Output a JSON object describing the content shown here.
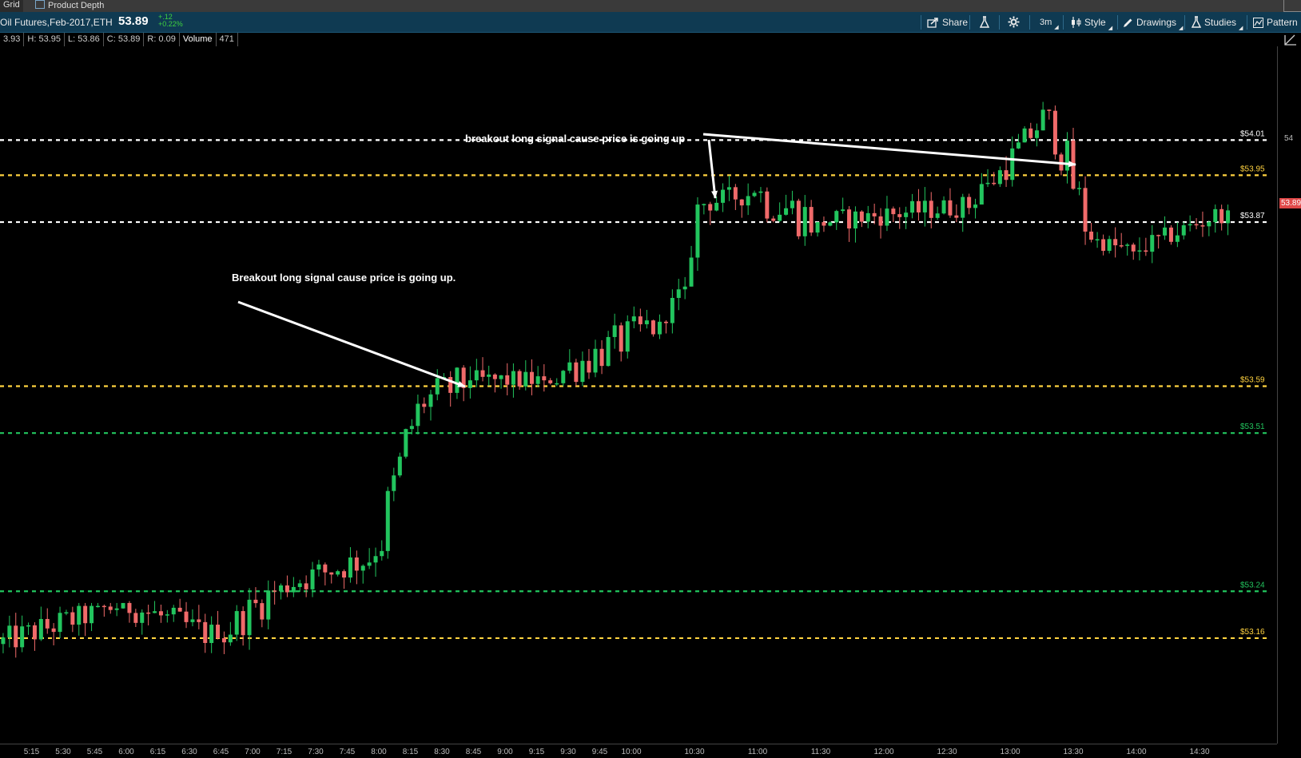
{
  "tabs": [
    {
      "label": "Grid"
    },
    {
      "label": "Product Depth"
    }
  ],
  "toolbar": {
    "symbol": "Oil Futures,Feb-2017,ETH",
    "last_price": "53.89",
    "change_abs": "+.12",
    "change_pct": "+0.22%",
    "share_label": "Share",
    "timeframe_label": "3m",
    "style_label": "Style",
    "drawings_label": "Drawings",
    "studies_label": "Studies",
    "patterns_label": "Pattern"
  },
  "infobar": {
    "open": "3.93",
    "high": "H: 53.95",
    "low": "L: 53.86",
    "close": "C: 53.89",
    "range": "R: 0.09",
    "volume_label": "Volume",
    "volume_value": "471"
  },
  "colors": {
    "up": "#22c55e",
    "down": "#f06a6a",
    "white_line": "#ffffff",
    "yellow_line": "#ffd23f",
    "green_line": "#22c55e",
    "toolbar": "#0f3a52"
  },
  "chart_data": {
    "type": "candlestick",
    "title": "",
    "xlabel": "",
    "ylabel": "",
    "ylim": [
      52.98,
      54.17
    ],
    "x_ticks": [
      "5:15",
      "5:30",
      "5:45",
      "6:00",
      "6:15",
      "6:30",
      "6:45",
      "7:00",
      "7:15",
      "7:30",
      "7:45",
      "8:00",
      "8:15",
      "8:30",
      "8:45",
      "9:00",
      "9:15",
      "9:30",
      "9:45",
      "10:00",
      "10:30",
      "11:00",
      "11:30",
      "12:00",
      "12:30",
      "13:00",
      "13:30",
      "14:00",
      "14:30"
    ],
    "y_ticks": [
      {
        "value": 54,
        "label": "54"
      }
    ],
    "last_price_badge": "53.89",
    "levels": [
      {
        "value": 54.01,
        "label": "$54.01",
        "color": "white"
      },
      {
        "value": 53.95,
        "label": "$53.95",
        "color": "yellow"
      },
      {
        "value": 53.87,
        "label": "$53.87",
        "color": "white"
      },
      {
        "value": 53.59,
        "label": "$53.59",
        "color": "yellow"
      },
      {
        "value": 53.51,
        "label": "$53.51",
        "color": "green"
      },
      {
        "value": 53.24,
        "label": "$53.24",
        "color": "green"
      },
      {
        "value": 53.16,
        "label": "$53.16",
        "color": "yellow"
      }
    ],
    "annotations": [
      {
        "text": "breakout long signal cause price is going up"
      },
      {
        "text": "Breakout long signal cause price is going up."
      }
    ],
    "segments": [
      {
        "from": "5:00",
        "to": "6:00",
        "start": 53.15,
        "end": 53.22,
        "low": 53.08,
        "high": 53.22
      },
      {
        "from": "6:00",
        "to": "6:45",
        "start": 53.22,
        "end": 53.16,
        "low": 53.12,
        "high": 53.27
      },
      {
        "from": "6:45",
        "to": "7:15",
        "start": 53.16,
        "end": 53.25,
        "low": 53.09,
        "high": 53.27
      },
      {
        "from": "7:15",
        "to": "8:00",
        "start": 53.25,
        "end": 53.3,
        "low": 53.23,
        "high": 53.38
      },
      {
        "from": "8:00",
        "to": "8:20",
        "start": 53.3,
        "end": 53.56,
        "low": 53.25,
        "high": 53.58
      },
      {
        "from": "8:20",
        "to": "8:45",
        "start": 53.56,
        "end": 53.6,
        "low": 53.48,
        "high": 53.67
      },
      {
        "from": "8:45",
        "to": "9:20",
        "start": 53.6,
        "end": 53.6,
        "low": 53.54,
        "high": 53.64
      },
      {
        "from": "9:20",
        "to": "10:15",
        "start": 53.6,
        "end": 53.7,
        "low": 53.59,
        "high": 53.78
      },
      {
        "from": "10:15",
        "to": "10:27",
        "start": 53.7,
        "end": 53.76,
        "low": 53.68,
        "high": 53.78
      },
      {
        "from": "10:27",
        "to": "10:33",
        "start": 53.76,
        "end": 53.9,
        "low": 53.76,
        "high": 53.92
      },
      {
        "from": "10:33",
        "to": "11:00",
        "start": 53.9,
        "end": 53.92,
        "low": 53.86,
        "high": 53.97
      },
      {
        "from": "11:00",
        "to": "11:30",
        "start": 53.92,
        "end": 53.87,
        "low": 53.7,
        "high": 53.93
      },
      {
        "from": "11:30",
        "to": "12:45",
        "start": 53.87,
        "end": 53.9,
        "low": 53.82,
        "high": 53.93
      },
      {
        "from": "12:45",
        "to": "13:20",
        "start": 53.9,
        "end": 54.06,
        "low": 53.93,
        "high": 54.08
      },
      {
        "from": "13:20",
        "to": "13:40",
        "start": 54.06,
        "end": 53.84,
        "low": 53.82,
        "high": 54.08
      },
      {
        "from": "13:40",
        "to": "14:00",
        "start": 53.84,
        "end": 53.82,
        "low": 53.8,
        "high": 53.88
      },
      {
        "from": "14:00",
        "to": "14:45",
        "start": 53.82,
        "end": 53.89,
        "low": 53.8,
        "high": 53.9
      }
    ]
  }
}
